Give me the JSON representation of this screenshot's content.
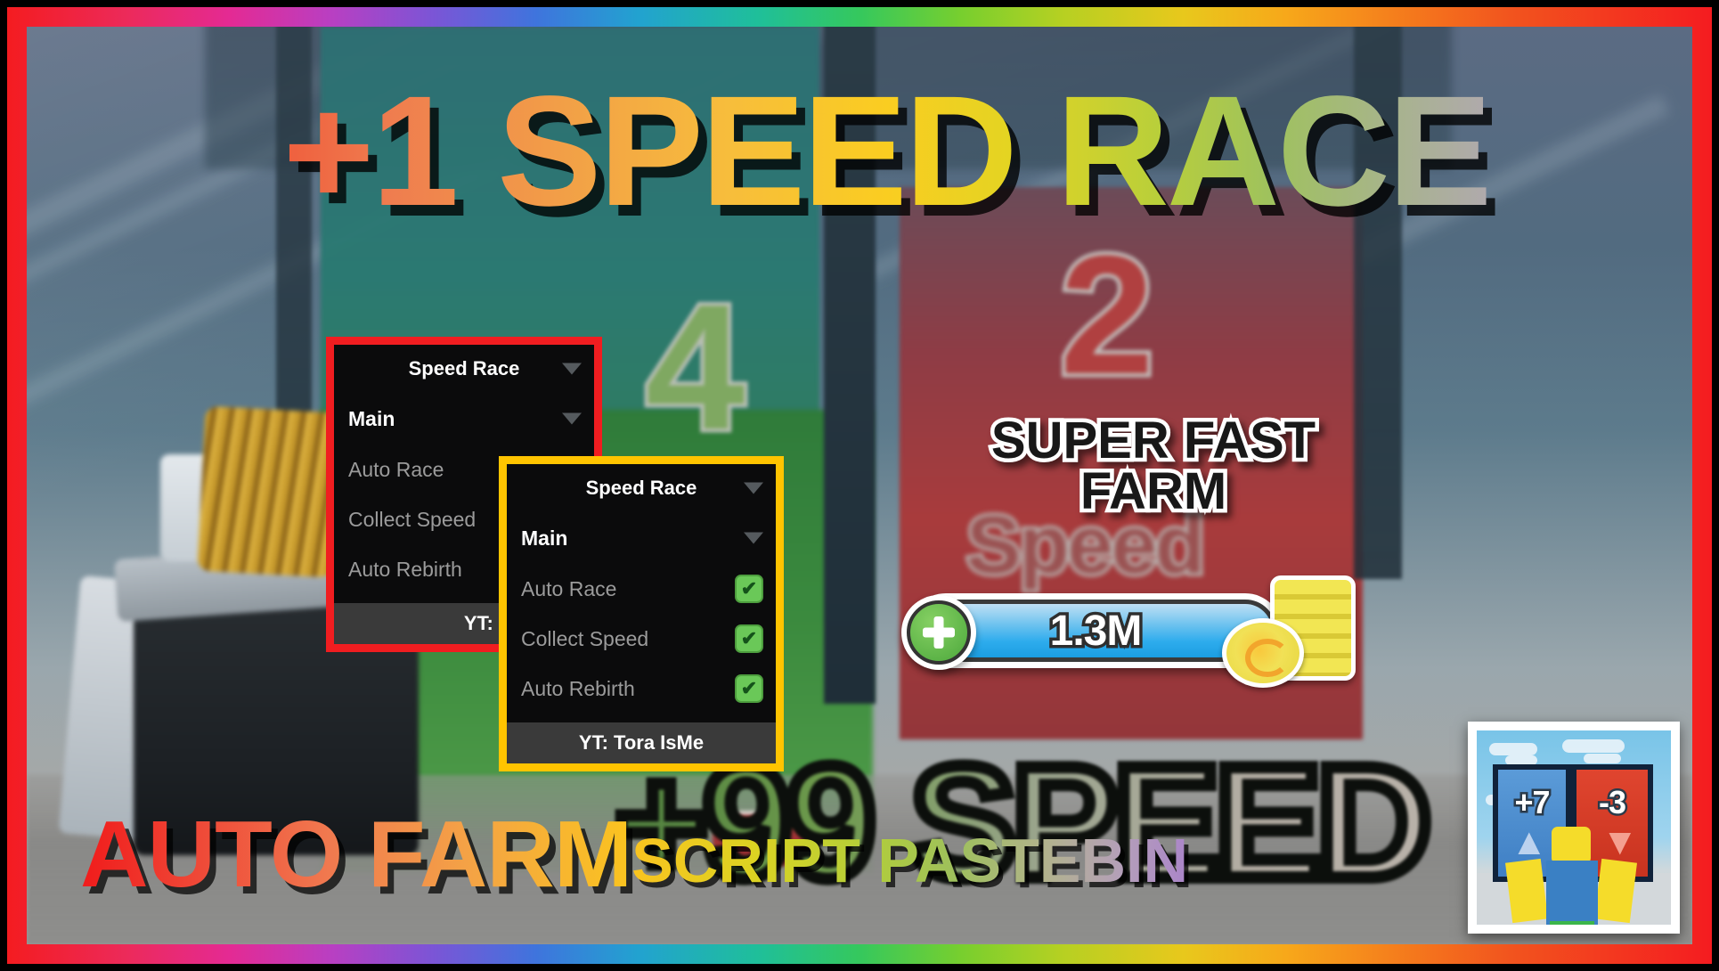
{
  "headline": {
    "text": "+1 SPEED RACE"
  },
  "promo": {
    "super_fast_farm_line1": "SUPER FAST",
    "super_fast_farm_line2": "FARM",
    "auto_farm": "AUTO FARM",
    "script_pastebin": "SCRIPT PASTEBIN"
  },
  "currency": {
    "amount": "1.3M",
    "plus_label": "+",
    "coin_icon": "coin-stack-icon"
  },
  "panels": [
    {
      "id": "panel-red",
      "border_color": "#f01d20",
      "title": "Speed Race",
      "section": "Main",
      "rows": [
        {
          "label": "Auto Race",
          "checked": false
        },
        {
          "label": "Collect Speed",
          "checked": false
        },
        {
          "label": "Auto Rebirth",
          "checked": false
        }
      ],
      "footer": "YT: Tora IsMe"
    },
    {
      "id": "panel-gold",
      "border_color": "#ffc400",
      "title": "Speed Race",
      "section": "Main",
      "rows": [
        {
          "label": "Auto Race",
          "checked": true
        },
        {
          "label": "Collect Speed",
          "checked": true
        },
        {
          "label": "Auto Rebirth",
          "checked": true
        }
      ],
      "footer": "YT: Tora IsMe"
    }
  ],
  "background": {
    "gate_number_green": "4",
    "gate_number_red": "2",
    "gate_word_red": "Speed",
    "big_text": "+99 SPEED"
  },
  "game_thumbnail": {
    "gate_positive": "+7",
    "gate_negative": "-3"
  },
  "colors": {
    "checkbox_green": "#6ac858",
    "panel_red_border": "#f01d20",
    "panel_gold_border": "#ffc400",
    "panel_background": "#0b0b0c",
    "panel_footer": "#3a3a3a",
    "currency_blue": "#2eaced"
  },
  "checkmark_glyph": "✔"
}
